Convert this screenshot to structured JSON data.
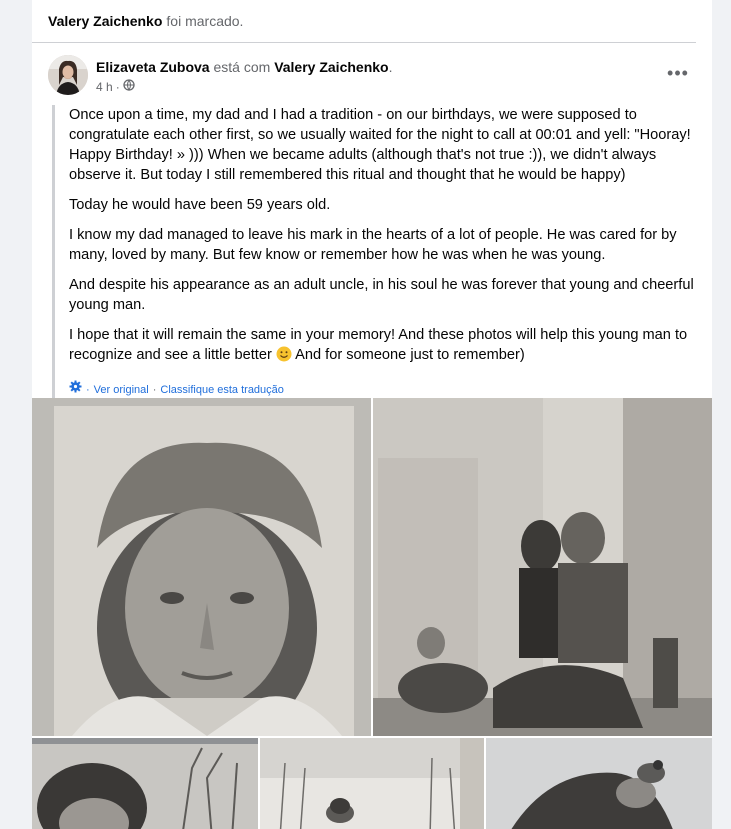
{
  "tag_line": {
    "name": "Valery Zaichenko",
    "suffix": "foi marcado."
  },
  "post": {
    "author": "Elizaveta Zubova",
    "with_text": "está com",
    "tagged": "Valery Zaichenko",
    "period": ".",
    "time": "4 h",
    "dot": "·",
    "more_label": "•••",
    "paragraphs": [
      "Once upon a time, my dad and I had a tradition - on our birthdays, we were supposed to congratulate each other first, so we usually waited for the night to call at 00:01 and yell: \"Hooray! Happy Birthday! » ))) When we became adults (although that's not true :)), we didn't always observe it. But today I still remembered this ritual and thought that he would be happy)",
      "Today he would have been 59 years old.",
      "I know my dad managed to leave his mark in the hearts of a lot of people. He was cared for by many, loved by many. But few know or remember how he was when he was young.",
      "And despite his appearance as an adult uncle, in his soul he was forever that young and cheerful young man."
    ],
    "last_paragraph_start": "I hope that it will remain the same in your memory! And these photos will help this young man to recognize and see a little better",
    "last_paragraph_end": "And for someone just to remember)",
    "translation": {
      "see_original": "Ver original",
      "separator": "·",
      "rate": "Classifique esta tradução"
    }
  }
}
